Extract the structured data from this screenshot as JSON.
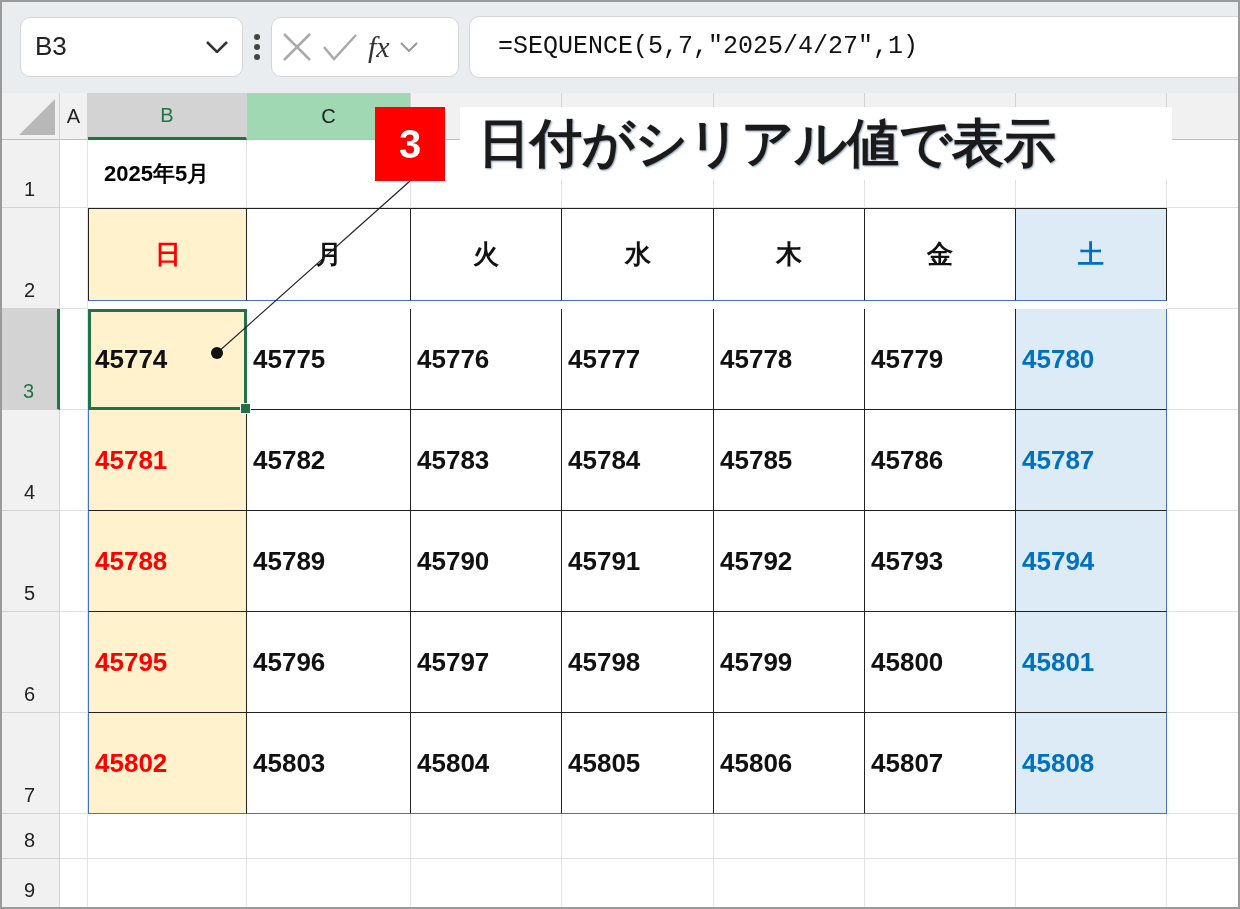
{
  "name_box": {
    "value": "B3"
  },
  "formula_bar": {
    "fx_label": "fx",
    "formula": "=SEQUENCE(5,7,\"2025/4/27\",1)"
  },
  "column_headers": [
    {
      "label": "A",
      "kind": "plain"
    },
    {
      "label": "B",
      "kind": "active"
    },
    {
      "label": "C",
      "kind": "range"
    }
  ],
  "row_headers": [
    {
      "label": "1",
      "selected": false
    },
    {
      "label": "2",
      "selected": false
    },
    {
      "label": "3",
      "selected": true
    },
    {
      "label": "4",
      "selected": false
    },
    {
      "label": "5",
      "selected": false
    },
    {
      "label": "6",
      "selected": false
    },
    {
      "label": "7",
      "selected": false
    },
    {
      "label": "8",
      "selected": false
    },
    {
      "label": "9",
      "selected": false
    }
  ],
  "title": "2025年5月",
  "table": {
    "columns": [
      {
        "label": "日",
        "kind": "sunday"
      },
      {
        "label": "月",
        "kind": "weekday"
      },
      {
        "label": "火",
        "kind": "weekday"
      },
      {
        "label": "水",
        "kind": "weekday"
      },
      {
        "label": "木",
        "kind": "weekday"
      },
      {
        "label": "金",
        "kind": "weekday"
      },
      {
        "label": "土",
        "kind": "saturday"
      }
    ],
    "rows": [
      {
        "cells": [
          {
            "text": "45774",
            "in_month": false
          },
          "45775",
          "45776",
          "45777",
          "45778",
          "45779",
          "45780"
        ]
      },
      {
        "cells": [
          "45781",
          "45782",
          "45783",
          "45784",
          "45785",
          "45786",
          "45787"
        ]
      },
      {
        "cells": [
          "45788",
          "45789",
          "45790",
          "45791",
          "45792",
          "45793",
          "45794"
        ]
      },
      {
        "cells": [
          "45795",
          "45796",
          "45797",
          "45798",
          "45799",
          "45800",
          "45801"
        ]
      },
      {
        "cells": [
          "45802",
          "45803",
          "45804",
          "45805",
          "45806",
          "45807",
          "45808"
        ]
      }
    ]
  },
  "callout": {
    "number": "3",
    "text": "日付がシリアル値で表示"
  }
}
